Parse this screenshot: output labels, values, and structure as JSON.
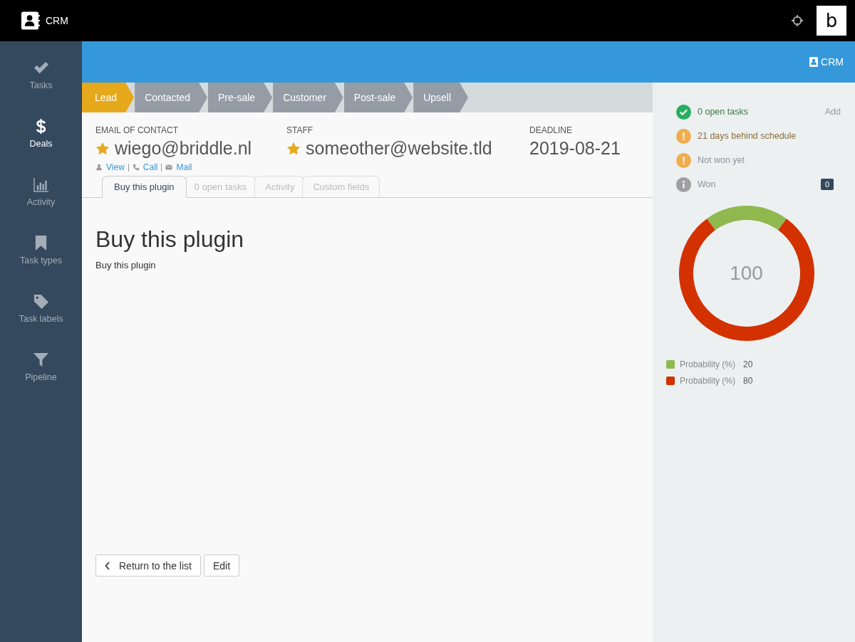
{
  "top_bar": {
    "app_name": "CRM",
    "avatar_letter": "b"
  },
  "sidebar": {
    "items": [
      {
        "label": "Tasks",
        "selected": false
      },
      {
        "label": "Deals",
        "selected": true
      },
      {
        "label": "Activity",
        "selected": false
      },
      {
        "label": "Task types",
        "selected": false
      },
      {
        "label": "Task labels",
        "selected": false
      },
      {
        "label": "Pipeline",
        "selected": false
      }
    ]
  },
  "header_bar": {
    "link": "CRM"
  },
  "pipeline": [
    {
      "label": "Lead",
      "selected": true
    },
    {
      "label": "Contacted",
      "selected": false
    },
    {
      "label": "Pre-sale",
      "selected": false
    },
    {
      "label": "Customer",
      "selected": false
    },
    {
      "label": "Post-sale",
      "selected": false
    },
    {
      "label": "Upsell",
      "selected": false
    }
  ],
  "fields": [
    {
      "label": "EMAIL OF CONTACT",
      "value": "wiego@briddle.nl",
      "starred": true
    },
    {
      "label": "STAFF",
      "value": "someother@website.tld",
      "starred": true
    },
    {
      "label": "DEADLINE",
      "value": "2019-08-21",
      "starred": false
    }
  ],
  "contact_links": [
    {
      "label": "View"
    },
    {
      "label": "Call"
    },
    {
      "label": "Mail"
    }
  ],
  "tabs": [
    {
      "label": "Buy this plugin",
      "selected": true
    },
    {
      "label": "0 open tasks",
      "selected": false
    },
    {
      "label": "Activity",
      "selected": false
    },
    {
      "label": "Custom fields",
      "selected": false
    }
  ],
  "content": {
    "title": "Buy this plugin",
    "body": "Buy this plugin"
  },
  "buttons": [
    {
      "label": "Return to the list",
      "kind": "back"
    },
    {
      "label": "Edit",
      "kind": "plain"
    }
  ],
  "status": [
    {
      "kind": "success",
      "text": "0 open tasks",
      "action": "Add"
    },
    {
      "kind": "warning",
      "text": "21 days behind schedule"
    },
    {
      "kind": "warning-muted",
      "text": "Not won yet"
    },
    {
      "kind": "info",
      "text": "Won",
      "badge": "0"
    }
  ],
  "donut_center": "100",
  "chart_data": {
    "type": "donut",
    "categories": [
      "Probability (%)",
      "Probability (%)"
    ],
    "values": [
      20,
      80
    ],
    "colors": [
      "#8fb84f",
      "#d33100"
    ],
    "value_labels": [
      "20",
      "80"
    ]
  }
}
